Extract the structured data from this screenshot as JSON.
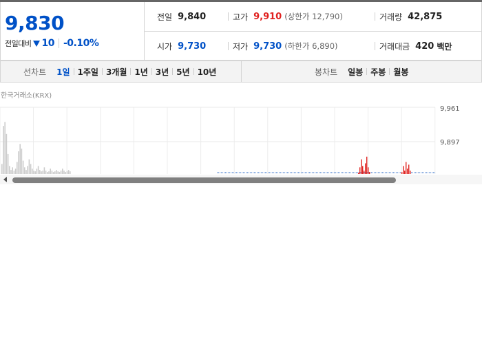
{
  "quote": {
    "current_price": "9,830",
    "change_label": "전일대비",
    "change_direction": "down",
    "change_value": "10",
    "change_rate": "-0.10%"
  },
  "info": {
    "prev_close": {
      "label": "전일",
      "value": "9,840"
    },
    "high": {
      "label": "고가",
      "value": "9,910",
      "sub": "(상한가 12,790)"
    },
    "volume": {
      "label": "거래량",
      "value": "42,875"
    },
    "open": {
      "label": "시가",
      "value": "9,730"
    },
    "low": {
      "label": "저가",
      "value": "9,730",
      "sub": "(하한가 6,890)"
    },
    "trade_value": {
      "label": "거래대금",
      "value": "420",
      "unit": "백만"
    }
  },
  "tabs": {
    "line_chart_title": "선차트",
    "line_periods": [
      "1일",
      "1주일",
      "3개월",
      "1년",
      "3년",
      "5년",
      "10년"
    ],
    "active_period": "1일",
    "candle_title": "봉차트",
    "candle_periods": [
      "일봉",
      "주봉",
      "월봉"
    ]
  },
  "market_label": "한국거래소(KRX)",
  "chart_data": {
    "type": "bar",
    "y_ticks": [
      "9,961",
      "9,897"
    ],
    "series": [
      {
        "color": "#cccccc",
        "values": [
          0.15,
          0.72,
          0.78,
          0.6,
          0.3,
          0.12,
          0.06,
          0.1,
          0.05,
          0.08,
          0.18,
          0.34,
          0.45,
          0.38,
          0.2,
          0.1,
          0.06,
          0.12,
          0.22,
          0.15,
          0.08,
          0.05,
          0.04,
          0.08,
          0.12,
          0.06,
          0.04,
          0.05,
          0.1,
          0.05,
          0.03,
          0.04,
          0.08,
          0.05,
          0.03,
          0.04,
          0.06,
          0.04,
          0.03,
          0.05,
          0.08,
          0.05,
          0.03,
          0.04,
          0.06,
          0.04
        ]
      },
      {
        "color": "#e0211f",
        "values": [
          0.02,
          0.1,
          0.22,
          0.12,
          0.05,
          0.16,
          0.26,
          0.1,
          0.03
        ]
      },
      {
        "color": "#e0211f",
        "values": [
          0.03,
          0.12,
          0.05,
          0.18,
          0.08,
          0.14,
          0.05
        ]
      }
    ]
  },
  "colors": {
    "up": "#e0211f",
    "down": "#0051c7"
  },
  "icons": {
    "scroll_left": "left-arrow-icon",
    "change_arrow": "triangle-down-icon"
  }
}
